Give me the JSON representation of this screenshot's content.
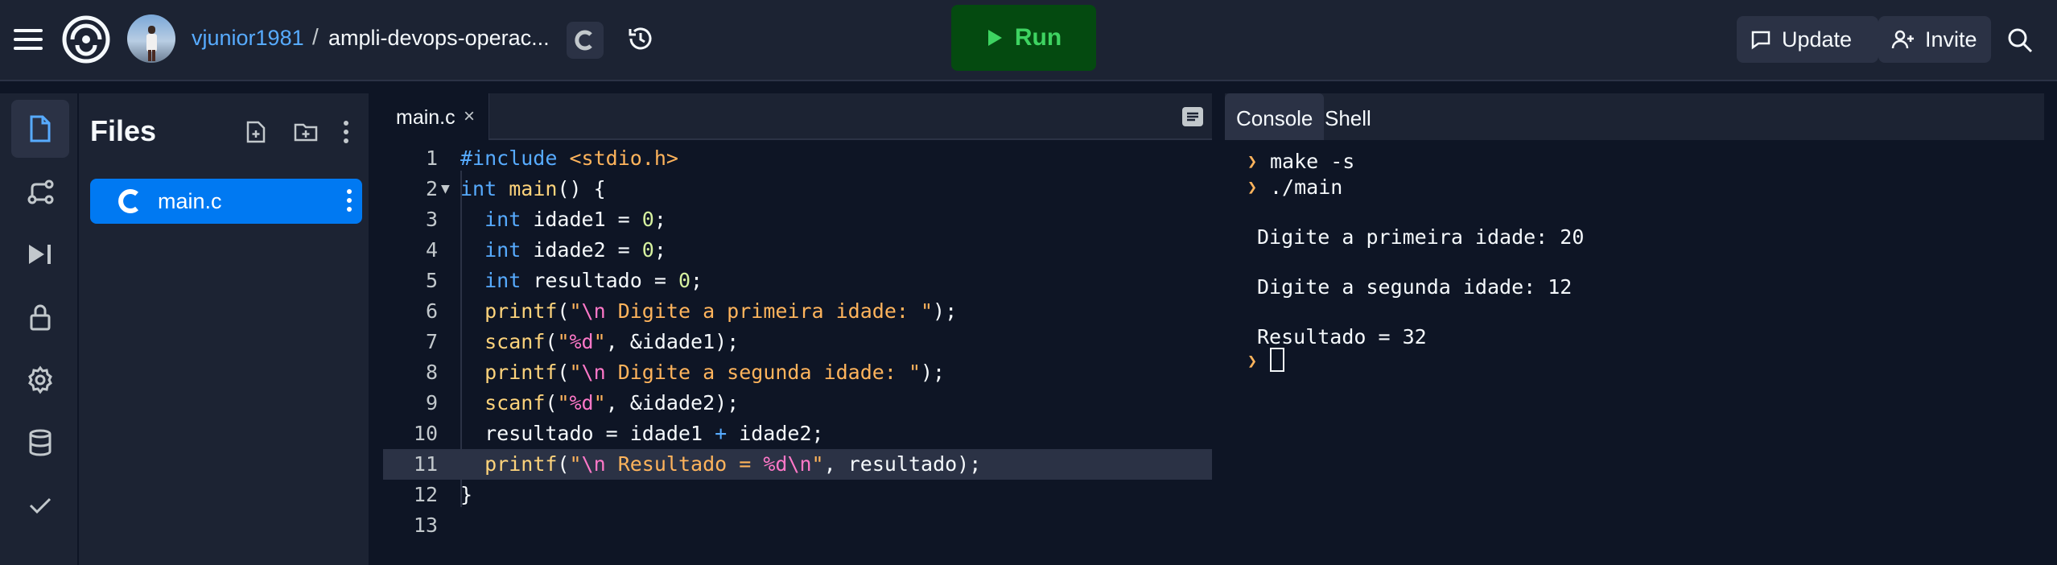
{
  "header": {
    "username": "vjunior1981",
    "separator": "/",
    "repl_name": "ampli-devops-operac...",
    "run_label": "Run",
    "update_label": "Update",
    "invite_label": "Invite"
  },
  "files_panel": {
    "title": "Files",
    "files": [
      {
        "name": "main.c",
        "icon": "c-language-icon",
        "selected": true
      }
    ]
  },
  "editor": {
    "tab_name": "main.c",
    "tab_close": "×",
    "highlighted_line": 11,
    "lines": [
      {
        "n": "1",
        "code": "#include <stdio.h>"
      },
      {
        "n": "2",
        "code": "int main() {"
      },
      {
        "n": "3",
        "code": "  int idade1 = 0;"
      },
      {
        "n": "4",
        "code": "  int idade2 = 0;"
      },
      {
        "n": "5",
        "code": "  int resultado = 0;"
      },
      {
        "n": "6",
        "code": "  printf(\"\\n Digite a primeira idade: \");"
      },
      {
        "n": "7",
        "code": "  scanf(\"%d\", &idade1);"
      },
      {
        "n": "8",
        "code": "  printf(\"\\n Digite a segunda idade: \");"
      },
      {
        "n": "9",
        "code": "  scanf(\"%d\", &idade2);"
      },
      {
        "n": "10",
        "code": "  resultado = idade1 + idade2;"
      },
      {
        "n": "11",
        "code": "  printf(\"\\n Resultado = %d\\n\", resultado);"
      },
      {
        "n": "12",
        "code": "}"
      },
      {
        "n": "13",
        "code": ""
      }
    ]
  },
  "console": {
    "tabs": [
      "Console",
      "Shell"
    ],
    "active_tab": "Console",
    "commands": [
      "make -s",
      "./main"
    ],
    "output": [
      "Digite a primeira idade: 20",
      "Digite a segunda idade: 12",
      "Resultado = 32"
    ]
  },
  "colors": {
    "background": "#0e1525",
    "panel": "#1c2333",
    "accent_blue": "#0079f2",
    "run_bg": "#044a10",
    "run_fg": "#3ed361"
  }
}
